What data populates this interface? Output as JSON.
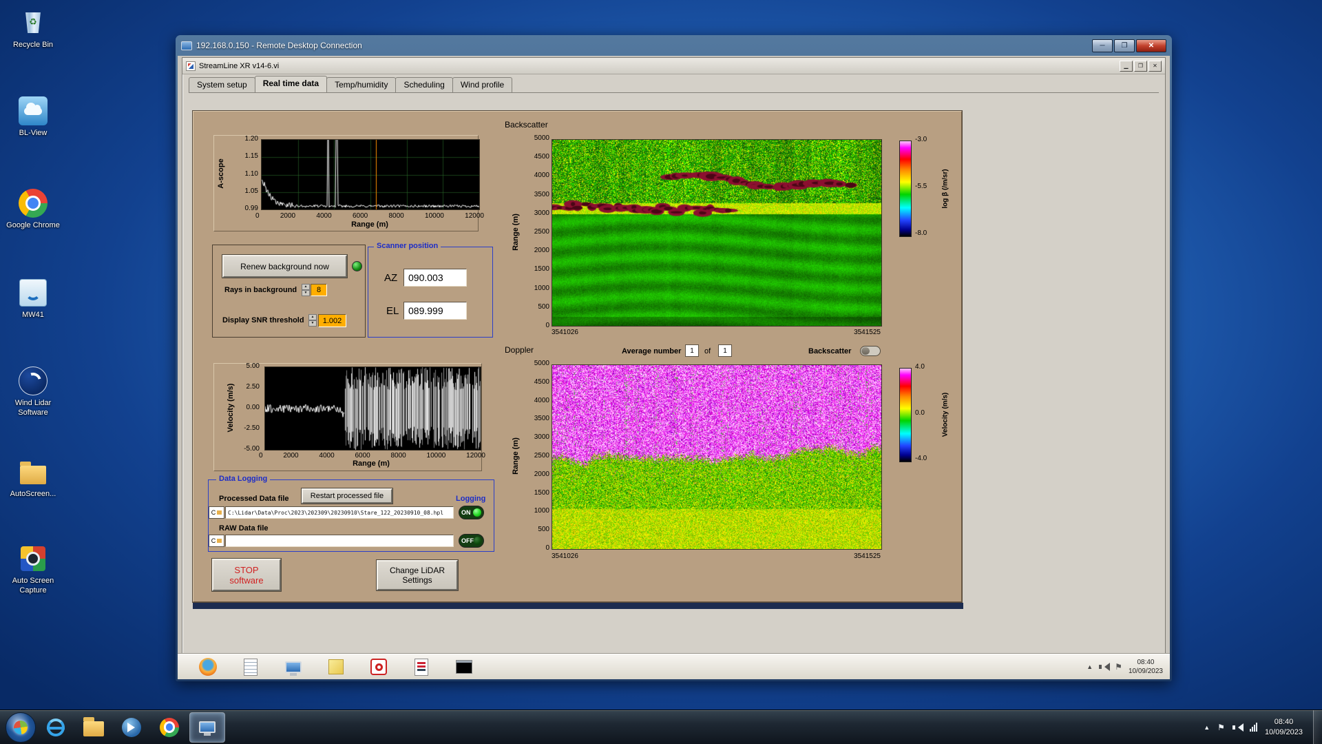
{
  "colors": {
    "panel_tan": "#b89f82",
    "accent_blue": "#1c2cc8",
    "value_orange": "#ffae00",
    "led_green": "#22d822",
    "stop_red": "#d02020"
  },
  "desktop": {
    "icons": [
      {
        "label": "Recycle Bin"
      },
      {
        "label": "BL-View"
      },
      {
        "label": "Google Chrome"
      },
      {
        "label": "MW41"
      },
      {
        "label": "Wind Lidar Software"
      },
      {
        "label": "AutoScreen..."
      },
      {
        "label": "Auto Screen Capture"
      }
    ]
  },
  "rdp": {
    "title": "192.168.0.150 - Remote Desktop Connection"
  },
  "app": {
    "title": "StreamLine XR v14-6.vi",
    "tabs": [
      "System setup",
      "Real time data",
      "Temp/humidity",
      "Scheduling",
      "Wind profile"
    ]
  },
  "ascope": {
    "ylabel": "A-scope",
    "xlabel": "Range (m)",
    "yticks": [
      "1.20",
      "1.15",
      "1.10",
      "1.05",
      "0.99"
    ],
    "xticks": [
      "0",
      "2000",
      "4000",
      "6000",
      "8000",
      "10000",
      "12000"
    ]
  },
  "controls": {
    "renew_label": "Renew background now",
    "rays_label": "Rays in background",
    "rays_value": "8",
    "snr_label": "Display SNR threshold",
    "snr_value": "1.002"
  },
  "scanner": {
    "title": "Scanner position",
    "az_label": "AZ",
    "az_value": "090.003",
    "el_label": "EL",
    "el_value": "089.999"
  },
  "backscatter": {
    "title": "Backscatter",
    "ylabel": "Range (m)",
    "yticks": [
      "5000",
      "4500",
      "4000",
      "3500",
      "3000",
      "2500",
      "2000",
      "1500",
      "1000",
      "500",
      "0"
    ],
    "x_start": "3541026",
    "x_end": "3541525",
    "cb_ticks": [
      "-3.0",
      "-5.5",
      "-8.0"
    ],
    "cb_label": "log β (/m/sr)"
  },
  "doppler_header": {
    "title": "Doppler",
    "avg_label": "Average number",
    "avg_value": "1",
    "of_label": "of",
    "count_value": "1",
    "toggle_label": "Backscatter"
  },
  "doppler": {
    "ylabel": "Range (m)",
    "yticks": [
      "5000",
      "4500",
      "4000",
      "3500",
      "3000",
      "2500",
      "2000",
      "1500",
      "1000",
      "500",
      "0"
    ],
    "x_start": "3541026",
    "x_end": "3541525",
    "cb_ticks": [
      "4.0",
      "0.0",
      "-4.0"
    ],
    "cb_label": "Velocity (m/s)"
  },
  "velocity": {
    "ylabel": "Velocity (m/s)",
    "xlabel": "Range (m)",
    "yticks": [
      "5.00",
      "2.50",
      "0.00",
      "-2.50",
      "-5.00"
    ],
    "xticks": [
      "0",
      "2000",
      "4000",
      "6000",
      "8000",
      "10000",
      "12000"
    ]
  },
  "logging": {
    "title": "Data Logging",
    "processed_label": "Processed Data file",
    "restart_button": "Restart processed file",
    "logging_label": "Logging",
    "drive": "C",
    "processed_path": "C:\\Lidar\\Data\\Proc\\2023\\202309\\20230910\\Stare_122_20230910_08.hpl",
    "raw_label": "RAW Data file",
    "raw_path": "",
    "on_label": "ON",
    "off_label": "OFF"
  },
  "actions": {
    "stop_line1": "STOP",
    "stop_line2": "software",
    "settings_line1": "Change LiDAR",
    "settings_line2": "Settings"
  },
  "remote_taskbar": {
    "time": "08:40",
    "date": "10/09/2023"
  },
  "host_taskbar": {
    "time": "08:40",
    "date": "10/09/2023"
  }
}
